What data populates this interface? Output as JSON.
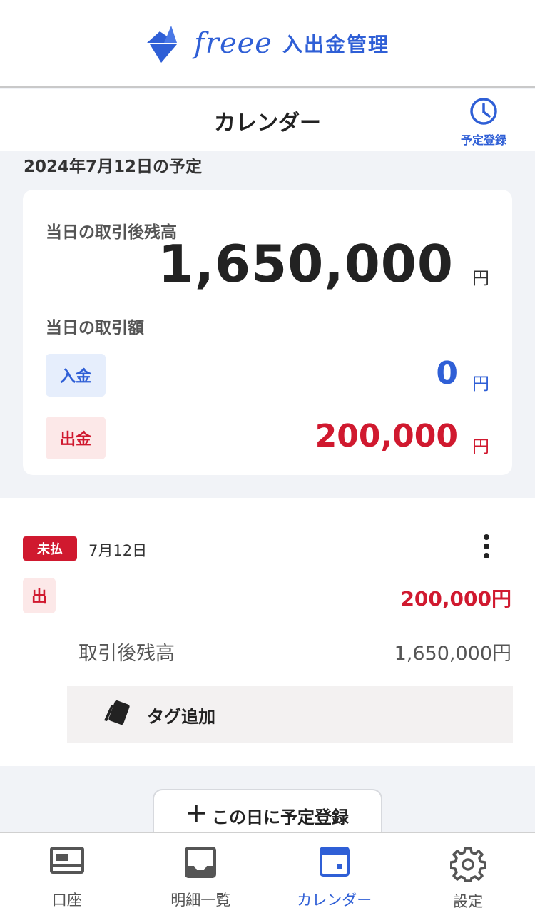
{
  "brand": {
    "word": "freee",
    "product": "入出金管理"
  },
  "header": {
    "title": "カレンダー",
    "schedule_label": "予定登録"
  },
  "date_heading": "2024年7月12日の予定",
  "summary": {
    "balance_label": "当日の取引後残高",
    "balance_value": "1,650,000",
    "currency": "円",
    "amount_label": "当日の取引額",
    "deposit_label": "入金",
    "deposit_value": "0",
    "withdrawal_label": "出金",
    "withdrawal_value": "200,000"
  },
  "transaction": {
    "status": "未払",
    "date": "7月12日",
    "type": "出",
    "amount": "200,000円",
    "balance_after_label": "取引後残高",
    "balance_after_value": "1,650,000円",
    "tag_button_label": "タグ追加"
  },
  "add_schedule_button": {
    "label": "この日に予定登録"
  },
  "bottom_nav": [
    {
      "label": "口座",
      "icon": "account-card-icon",
      "active": false
    },
    {
      "label": "明細一覧",
      "icon": "inbox-tray-icon",
      "active": false
    },
    {
      "label": "カレンダー",
      "icon": "calendar-icon",
      "active": true
    },
    {
      "label": "設定",
      "icon": "gear-icon",
      "active": false
    }
  ],
  "colors": {
    "accent": "#2f5fd6",
    "danger": "#d0192f",
    "background": "#f1f3f7"
  }
}
